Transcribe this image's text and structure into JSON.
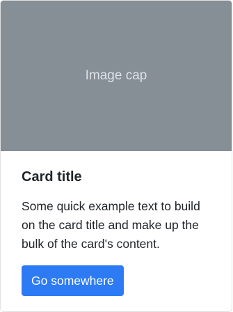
{
  "card": {
    "image_cap": "Image cap",
    "title": "Card title",
    "text": "Some quick example text to build on the card title and make up the bulk of the card's content.",
    "button_label": "Go somewhere"
  },
  "colors": {
    "image_bg": "#868e96",
    "button_bg": "#2c7bf5",
    "text": "#212529"
  }
}
